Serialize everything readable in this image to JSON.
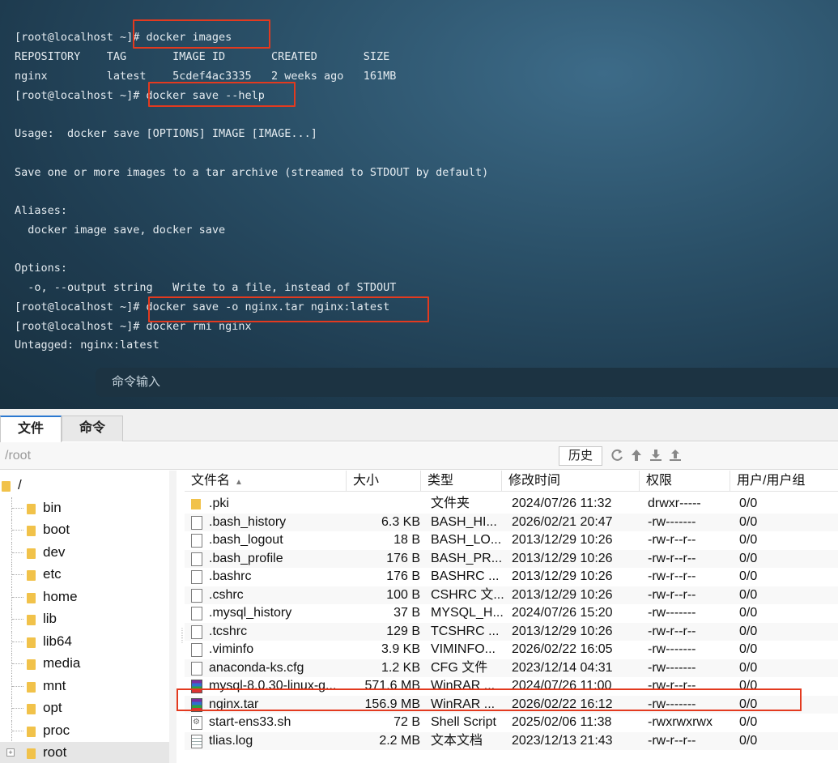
{
  "terminal": {
    "lines": [
      "[root@localhost ~]# docker images",
      "REPOSITORY    TAG       IMAGE ID       CREATED       SIZE",
      "nginx         latest    5cdef4ac3335   2 weeks ago   161MB",
      "[root@localhost ~]# docker save --help",
      "",
      "Usage:  docker save [OPTIONS] IMAGE [IMAGE...]",
      "",
      "Save one or more images to a tar archive (streamed to STDOUT by default)",
      "",
      "Aliases:",
      "  docker image save, docker save",
      "",
      "Options:",
      "  -o, --output string   Write to a file, instead of STDOUT",
      "[root@localhost ~]# docker save -o nginx.tar nginx:latest",
      "[root@localhost ~]# docker rmi nginx",
      "Untagged: nginx:latest"
    ],
    "input_placeholder": "命令输入",
    "highlight_color": "#e33a1f"
  },
  "file_manager": {
    "tabs": [
      {
        "label": "文件",
        "active": true
      },
      {
        "label": "命令",
        "active": false
      }
    ],
    "path": "/root",
    "history_label": "历史",
    "toolbar_icons": [
      "refresh-icon",
      "up-icon",
      "download-icon",
      "upload-icon"
    ],
    "tree": {
      "root_label": "/",
      "items": [
        "bin",
        "boot",
        "dev",
        "etc",
        "home",
        "lib",
        "lib64",
        "media",
        "mnt",
        "opt",
        "proc",
        "root"
      ],
      "selected": "root"
    },
    "columns": [
      "文件名",
      "大小",
      "类型",
      "修改时间",
      "权限",
      "用户/用户组"
    ],
    "files": [
      {
        "name": ".pki",
        "size": "",
        "type": "文件夹",
        "modified": "2024/07/26 11:32",
        "perm": "drwxr-----",
        "owner": "0/0",
        "icon": "folder"
      },
      {
        "name": ".bash_history",
        "size": "6.3 KB",
        "type": "BASH_HI...",
        "modified": "2026/02/21 20:47",
        "perm": "-rw-------",
        "owner": "0/0",
        "icon": "doc"
      },
      {
        "name": ".bash_logout",
        "size": "18 B",
        "type": "BASH_LO...",
        "modified": "2013/12/29 10:26",
        "perm": "-rw-r--r--",
        "owner": "0/0",
        "icon": "doc"
      },
      {
        "name": ".bash_profile",
        "size": "176 B",
        "type": "BASH_PR...",
        "modified": "2013/12/29 10:26",
        "perm": "-rw-r--r--",
        "owner": "0/0",
        "icon": "doc"
      },
      {
        "name": ".bashrc",
        "size": "176 B",
        "type": "BASHRC ...",
        "modified": "2013/12/29 10:26",
        "perm": "-rw-r--r--",
        "owner": "0/0",
        "icon": "doc"
      },
      {
        "name": ".cshrc",
        "size": "100 B",
        "type": "CSHRC 文...",
        "modified": "2013/12/29 10:26",
        "perm": "-rw-r--r--",
        "owner": "0/0",
        "icon": "doc"
      },
      {
        "name": ".mysql_history",
        "size": "37 B",
        "type": "MYSQL_H...",
        "modified": "2024/07/26 15:20",
        "perm": "-rw-------",
        "owner": "0/0",
        "icon": "doc"
      },
      {
        "name": ".tcshrc",
        "size": "129 B",
        "type": "TCSHRC ...",
        "modified": "2013/12/29 10:26",
        "perm": "-rw-r--r--",
        "owner": "0/0",
        "icon": "doc"
      },
      {
        "name": ".viminfo",
        "size": "3.9 KB",
        "type": "VIMINFO...",
        "modified": "2026/02/22 16:05",
        "perm": "-rw-------",
        "owner": "0/0",
        "icon": "doc"
      },
      {
        "name": "anaconda-ks.cfg",
        "size": "1.2 KB",
        "type": "CFG 文件",
        "modified": "2023/12/14 04:31",
        "perm": "-rw-------",
        "owner": "0/0",
        "icon": "doc"
      },
      {
        "name": "mysql-8.0.30-linux-g...",
        "size": "571.6 MB",
        "type": "WinRAR ...",
        "modified": "2024/07/26 11:00",
        "perm": "-rw-r--r--",
        "owner": "0/0",
        "icon": "rar"
      },
      {
        "name": "nginx.tar",
        "size": "156.9 MB",
        "type": "WinRAR ...",
        "modified": "2026/02/22 16:12",
        "perm": "-rw-------",
        "owner": "0/0",
        "icon": "rar"
      },
      {
        "name": "start-ens33.sh",
        "size": "72 B",
        "type": "Shell Script",
        "modified": "2025/02/06 11:38",
        "perm": "-rwxrwxrwx",
        "owner": "0/0",
        "icon": "sh"
      },
      {
        "name": "tlias.log",
        "size": "2.2 MB",
        "type": "文本文档",
        "modified": "2023/12/13 21:43",
        "perm": "-rw-r--r--",
        "owner": "0/0",
        "icon": "txt"
      }
    ]
  }
}
